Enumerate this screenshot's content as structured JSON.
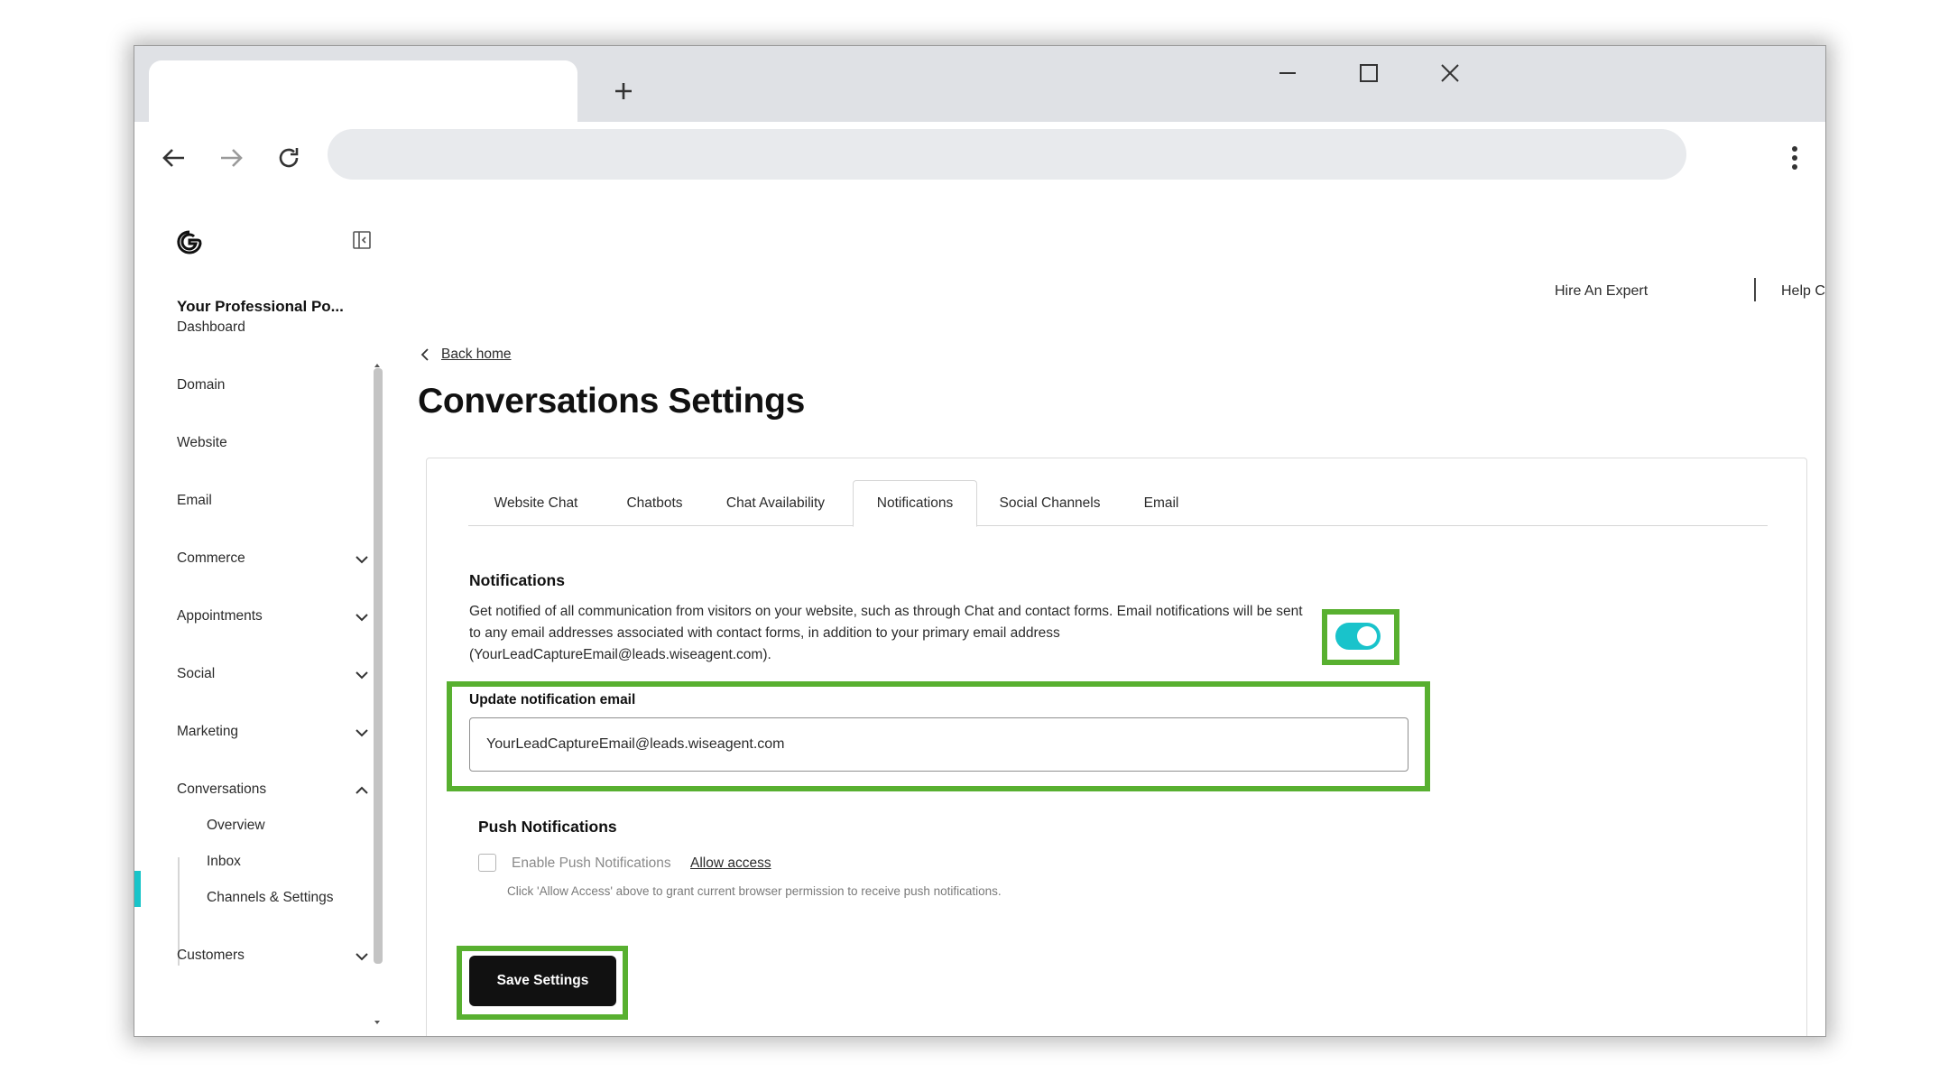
{
  "browser": {
    "tab_title": "",
    "url": ""
  },
  "sidebar": {
    "site_name": "Your Professional Po...",
    "items": [
      {
        "label": "Dashboard"
      },
      {
        "label": "Domain"
      },
      {
        "label": "Website"
      },
      {
        "label": "Email"
      },
      {
        "label": "Commerce"
      },
      {
        "label": "Appointments"
      },
      {
        "label": "Social"
      },
      {
        "label": "Marketing"
      },
      {
        "label": "Conversations"
      },
      {
        "label": "Customers"
      }
    ],
    "conversations_subitems": [
      {
        "label": "Overview"
      },
      {
        "label": "Inbox"
      },
      {
        "label": "Channels & Settings"
      }
    ]
  },
  "header": {
    "hire_expert": "Hire An Expert",
    "help_center": "Help Center"
  },
  "page": {
    "back_label": "Back home",
    "title": "Conversations Settings"
  },
  "tabs": [
    {
      "label": "Website Chat"
    },
    {
      "label": "Chatbots"
    },
    {
      "label": "Chat Availability"
    },
    {
      "label": "Notifications"
    },
    {
      "label": "Social Channels"
    },
    {
      "label": "Email"
    }
  ],
  "notifications": {
    "title": "Notifications",
    "description": "Get notified of all communication from visitors on your website, such as through Chat and contact forms. Email notifications will be sent to any email addresses associated with contact forms, in addition to your primary email address (YourLeadCaptureEmail@leads.wiseagent.com).",
    "toggle_on": true,
    "field_label": "Update notification email",
    "email_value": "YourLeadCaptureEmail@leads.wiseagent.com"
  },
  "push": {
    "title": "Push Notifications",
    "checkbox_label": "Enable Push Notifications",
    "allow_link": "Allow access",
    "help_text": "Click 'Allow Access' above to grant current browser permission to receive push notifications.",
    "checked": false
  },
  "actions": {
    "save_label": "Save Settings"
  },
  "colors": {
    "accent": "#19c3cb",
    "highlight": "#58b030",
    "button_bg": "#111111"
  }
}
